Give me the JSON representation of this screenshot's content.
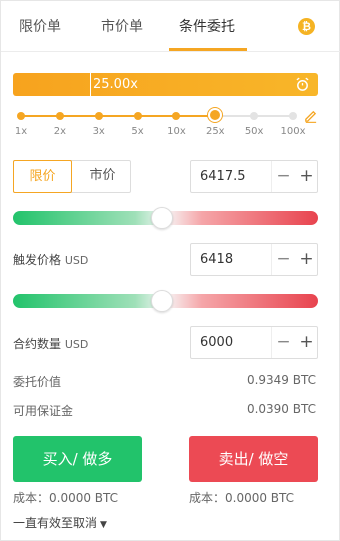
{
  "tabs": [
    {
      "label": "限价单"
    },
    {
      "label": "市价单"
    },
    {
      "label": "条件委托"
    }
  ],
  "coin_icon": "bitcoin-icon",
  "leverage": {
    "current": "25.00x",
    "level_fraction": 0.78,
    "ticks": [
      "1x",
      "2x",
      "3x",
      "5x",
      "10x",
      "25x",
      "50x",
      "100x"
    ],
    "selected_index": 5
  },
  "order_type": {
    "limit": "限价",
    "market": "市价"
  },
  "price": {
    "value": "6417.5",
    "minus": "−",
    "plus": "+"
  },
  "trigger": {
    "label": "触发价格",
    "unit": "USD",
    "value": "6418",
    "minus": "−",
    "plus": "+"
  },
  "quantity": {
    "label": "合约数量",
    "unit": "USD",
    "value": "6000",
    "minus": "−",
    "plus": "+"
  },
  "slider1_position": 0.49,
  "slider2_position": 0.49,
  "info": {
    "order_value_label": "委托价值",
    "order_value": "0.9349 BTC",
    "margin_label": "可用保证金",
    "margin": "0.0390 BTC"
  },
  "actions": {
    "buy": "买入/ 做多",
    "sell": "卖出/ 做空"
  },
  "cost": {
    "buy": "成本：0.0000 BTC",
    "sell": "成本：0.0000 BTC"
  },
  "validity": {
    "label": "一直有效至取消",
    "caret": "▼"
  },
  "colors": {
    "accent": "#f5a623",
    "buy": "#22c36b",
    "sell": "#ec4a54"
  }
}
